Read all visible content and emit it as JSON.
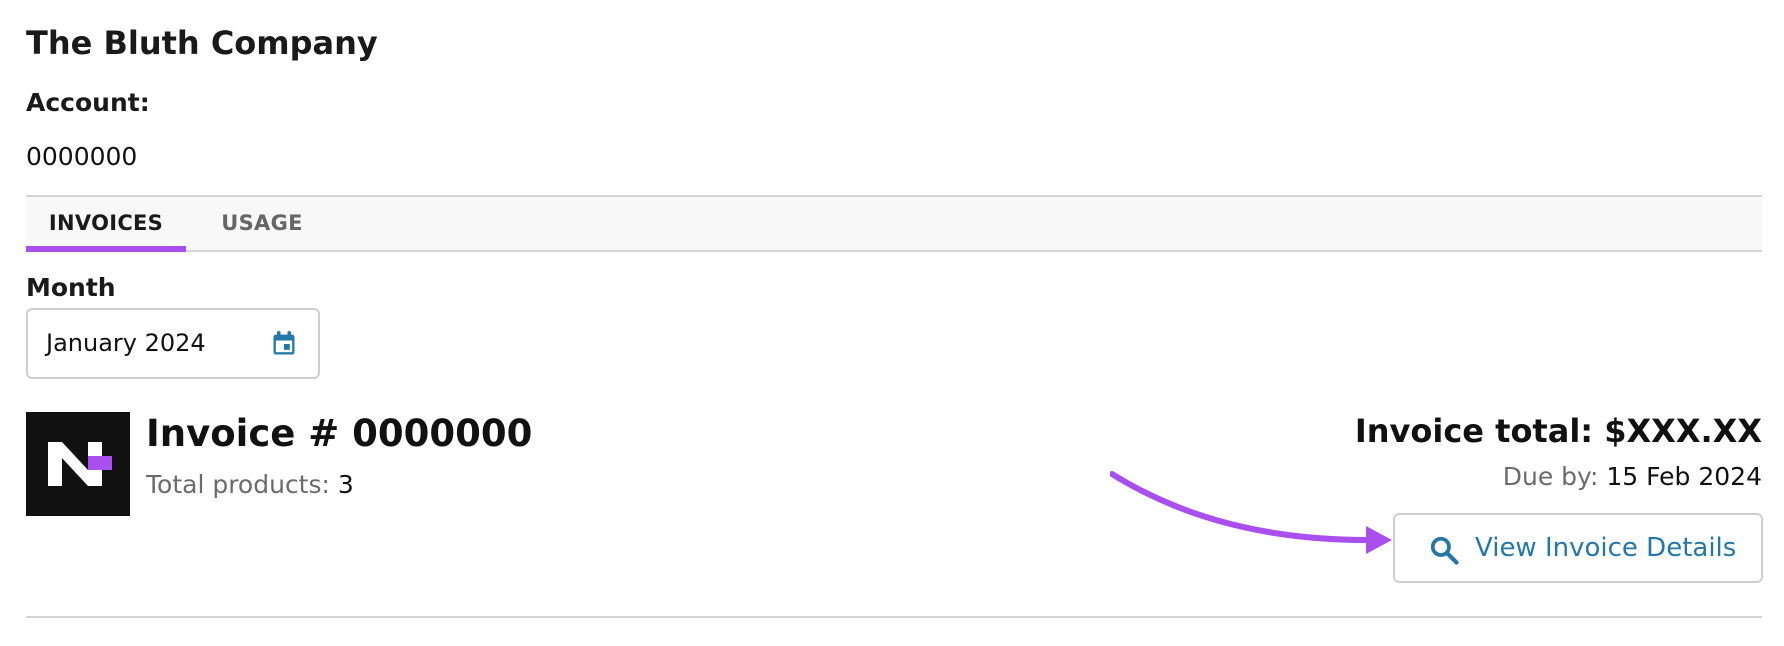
{
  "header": {
    "company_name": "The Bluth Company",
    "account_label": "Account:",
    "account_number": "0000000"
  },
  "tabs": [
    {
      "label": "INVOICES",
      "active": true
    },
    {
      "label": "USAGE",
      "active": false
    }
  ],
  "filter": {
    "month_label": "Month",
    "month_value": "January 2024",
    "calendar_icon": "calendar-icon"
  },
  "invoice": {
    "logo_icon": "n-logo",
    "number_text": "Invoice # 0000000",
    "total_products_label": "Total products:",
    "total_products_value": "3",
    "total_text": "Invoice total: $XXX.XX",
    "due_label": "Due by:",
    "due_value": "15 Feb 2024",
    "view_button_label": "View Invoice Details",
    "view_button_icon": "search-icon"
  },
  "colors": {
    "accent": "#a94ff0",
    "link": "#2477a8",
    "muted_text": "#6b6b6b",
    "border": "#d4d4d4"
  }
}
